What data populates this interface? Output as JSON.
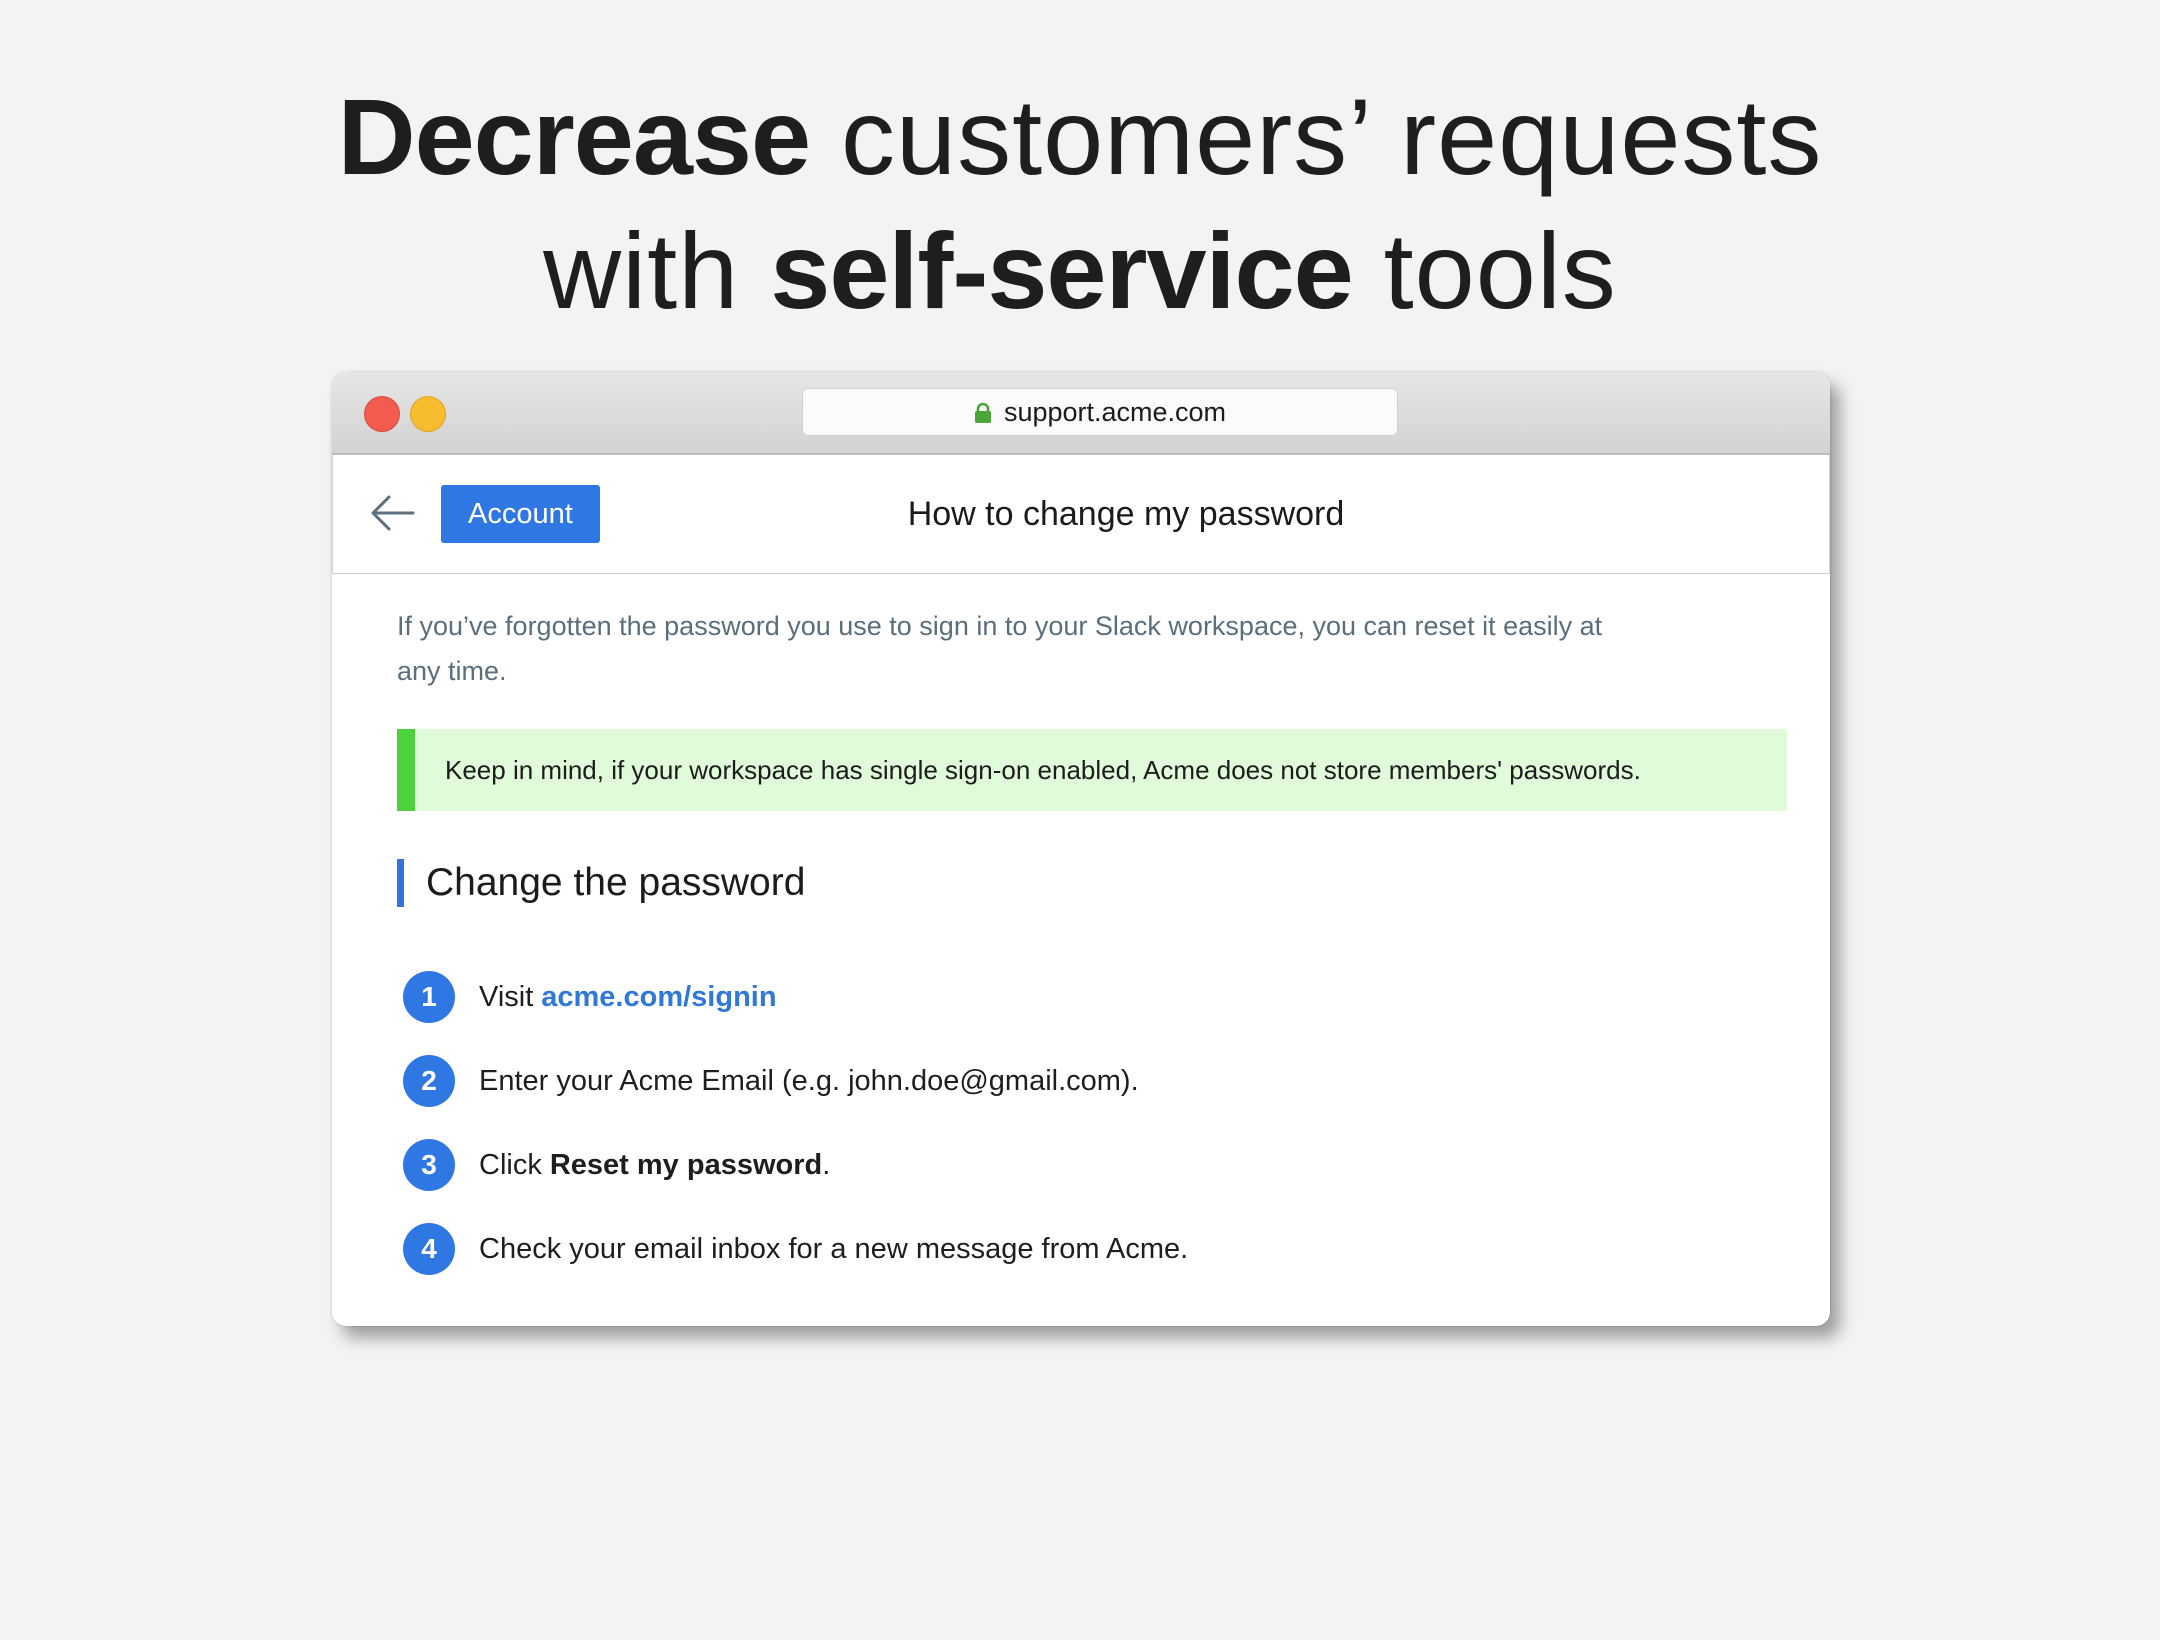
{
  "headline": {
    "line1_bold": "Decrease",
    "line1_rest": " customers’ requests",
    "line2_start": "with ",
    "line2_bold": "self-service",
    "line2_end": " tools"
  },
  "browser": {
    "url": "support.acme.com",
    "colors": {
      "close": "#f35b50",
      "minimize": "#f8bd2e",
      "lock": "#4aa53a"
    }
  },
  "nav": {
    "back_icon": "arrow-left-icon",
    "category_button": "Account",
    "title": "How to change my password"
  },
  "article": {
    "intro": "If you’ve forgotten the password you use to sign in to your Slack workspace, you can reset it easily at any time.",
    "note": "Keep in mind, if your workspace has single sign-on enabled, Acme does not store members' passwords.",
    "section_title": "Change the password",
    "steps": [
      {
        "number": "1",
        "text": "Visit",
        "link": "acme.com/signin"
      },
      {
        "number": "2",
        "text": "Enter your Acme Email (e.g. john.doe@gmail.com)."
      },
      {
        "number": "3",
        "text": "Click",
        "bold": "Reset my password",
        "suffix": "."
      },
      {
        "number": "4",
        "text": "Check your email inbox for a new message from Acme."
      }
    ]
  },
  "colors": {
    "accent": "#2f77e3",
    "note_bg": "#e0fbd9",
    "note_bar": "#4dd23b"
  }
}
